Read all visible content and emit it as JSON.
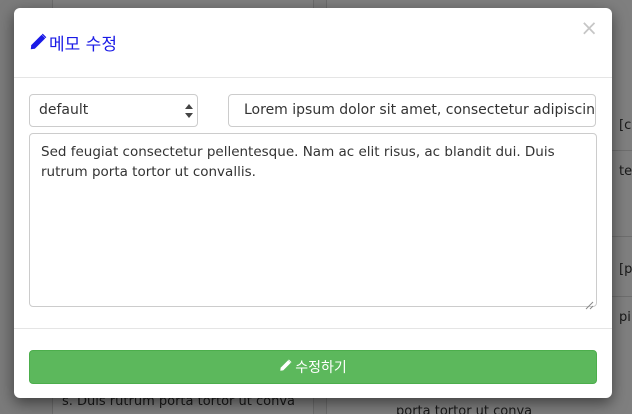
{
  "background": {
    "side_labels": [
      "[c",
      "te",
      "[p",
      "pi"
    ],
    "bottom_text": "s. Duis rutrum porta tortor ut conva",
    "bottom_text_2": "porta tortor ut conva"
  },
  "modal": {
    "title_icon": "pencil-icon",
    "title": "메모 수정",
    "close_glyph": "×",
    "category_select": {
      "value": "default"
    },
    "title_input": {
      "value": "Lorem ipsum dolor sit amet, consectetur adipiscing elit."
    },
    "memo_textarea": {
      "value": "Sed feugiat consectetur pellentesque. Nam ac elit risus, ac blandit dui. Duis rutrum porta tortor ut convallis."
    },
    "submit_button": {
      "icon": "pencil-icon",
      "label": "수정하기"
    }
  },
  "colors": {
    "title": "#1a1ae6",
    "submit_bg": "#5cb85c",
    "overlay": "rgba(0,0,0,0.5)"
  }
}
